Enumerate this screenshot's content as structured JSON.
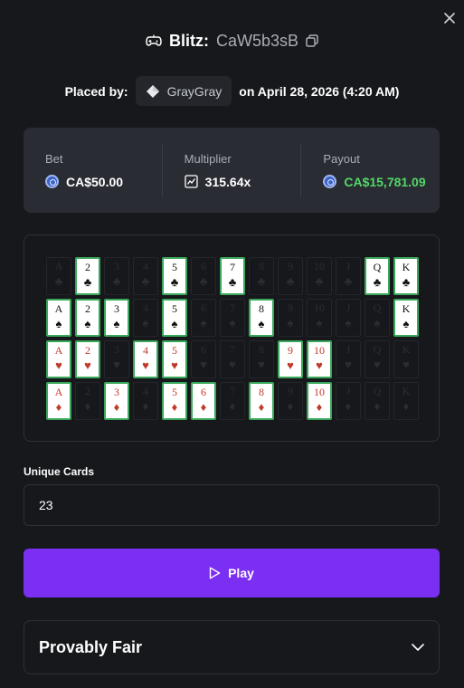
{
  "modal": {
    "game_name": "Blitz:",
    "bet_id": "CaW5b3sB",
    "placed_by_label": "Placed by:",
    "username": "GrayGray",
    "placed_on": "on April 28, 2026 (4:20 AM)"
  },
  "stats": {
    "bet_label": "Bet",
    "bet_value": "CA$50.00",
    "multiplier_label": "Multiplier",
    "multiplier_value": "315.64x",
    "payout_label": "Payout",
    "payout_value": "CA$15,781.09",
    "payout_color": "#53d769"
  },
  "board": {
    "ranks": [
      "A",
      "2",
      "3",
      "4",
      "5",
      "6",
      "7",
      "8",
      "9",
      "10",
      "J",
      "Q",
      "K"
    ],
    "rows": [
      {
        "suit": "♣",
        "color": "black",
        "selected": [
          false,
          true,
          false,
          false,
          true,
          false,
          true,
          false,
          false,
          false,
          false,
          true,
          true
        ]
      },
      {
        "suit": "♠",
        "color": "black",
        "selected": [
          true,
          true,
          true,
          false,
          true,
          false,
          false,
          true,
          false,
          false,
          false,
          false,
          true
        ]
      },
      {
        "suit": "♥",
        "color": "red",
        "selected": [
          true,
          true,
          false,
          true,
          true,
          false,
          false,
          false,
          true,
          true,
          false,
          false,
          false
        ]
      },
      {
        "suit": "♦",
        "color": "red",
        "selected": [
          true,
          false,
          true,
          false,
          true,
          true,
          false,
          true,
          false,
          true,
          false,
          false,
          false
        ]
      }
    ]
  },
  "unique_cards": {
    "label": "Unique Cards",
    "value": "23"
  },
  "play_button": {
    "label": "Play"
  },
  "provably_fair": {
    "label": "Provably Fair"
  },
  "colors": {
    "accent": "#7a2ff2",
    "card_border_selected": "#3aa85a",
    "red_suit": "#c0392b",
    "background": "#17181c"
  }
}
